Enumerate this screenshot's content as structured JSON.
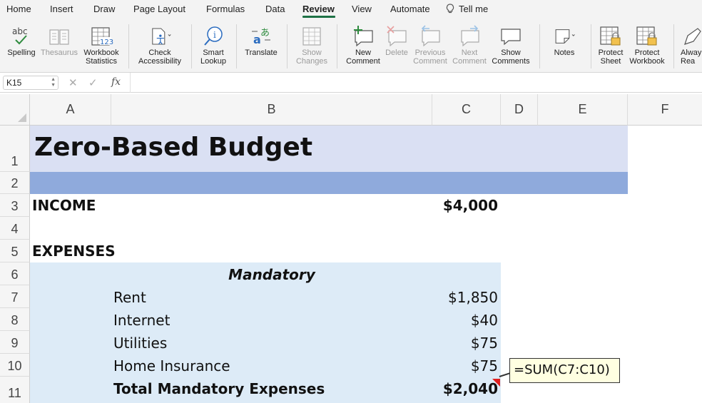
{
  "menu": {
    "tabs": [
      "Home",
      "Insert",
      "Draw",
      "Page Layout",
      "Formulas",
      "Data",
      "Review",
      "View",
      "Automate"
    ],
    "active_tab": "Review",
    "tell_me": "Tell me"
  },
  "ribbon": {
    "buttons": [
      {
        "line1": "Spelling",
        "line2": "",
        "icon": "spelling-icon",
        "enabled": true,
        "icon_text": "abc"
      },
      {
        "line1": "Thesaurus",
        "line2": "",
        "icon": "thesaurus-icon",
        "enabled": false
      },
      {
        "line1": "Workbook",
        "line2": "Statistics",
        "icon": "workbook-statistics-icon",
        "enabled": true,
        "icon_text": "123"
      },
      {
        "line1": "Check",
        "line2": "Accessibility",
        "icon": "accessibility-icon",
        "enabled": true
      },
      {
        "line1": "Smart",
        "line2": "Lookup",
        "icon": "smart-lookup-icon",
        "enabled": true
      },
      {
        "line1": "Translate",
        "line2": "",
        "icon": "translate-icon",
        "enabled": true
      },
      {
        "line1": "Show",
        "line2": "Changes",
        "icon": "show-changes-icon",
        "enabled": false
      },
      {
        "line1": "New",
        "line2": "Comment",
        "icon": "new-comment-icon",
        "enabled": true
      },
      {
        "line1": "Delete",
        "line2": "",
        "icon": "delete-comment-icon",
        "enabled": false
      },
      {
        "line1": "Previous",
        "line2": "Comment",
        "icon": "previous-comment-icon",
        "enabled": false
      },
      {
        "line1": "Next",
        "line2": "Comment",
        "icon": "next-comment-icon",
        "enabled": false
      },
      {
        "line1": "Show",
        "line2": "Comments",
        "icon": "show-comments-icon",
        "enabled": true
      },
      {
        "line1": "Notes",
        "line2": "",
        "icon": "notes-icon",
        "enabled": true
      },
      {
        "line1": "Protect",
        "line2": "Sheet",
        "icon": "protect-sheet-icon",
        "enabled": true
      },
      {
        "line1": "Protect",
        "line2": "Workbook",
        "icon": "protect-workbook-icon",
        "enabled": true
      },
      {
        "line1": "Alway",
        "line2": "Rea",
        "icon": "always-read-icon",
        "enabled": true
      }
    ]
  },
  "formula_bar": {
    "cell_ref": "K15",
    "cancel": "✕",
    "enter": "✓",
    "fx": "fx",
    "value": ""
  },
  "columns": [
    "A",
    "B",
    "C",
    "D",
    "E",
    "F"
  ],
  "rows": [
    "1",
    "2",
    "3",
    "4",
    "5",
    "6",
    "7",
    "8",
    "9",
    "10",
    "11"
  ],
  "sheet": {
    "title": "Zero-Based Budget",
    "income_label": "INCOME",
    "income_value": "$4,000",
    "expenses_label": "EXPENSES",
    "mandatory_header": "Mandatory",
    "items": [
      {
        "label": "Rent",
        "value": "$1,850"
      },
      {
        "label": "Internet",
        "value": "$40"
      },
      {
        "label": "Utilities",
        "value": "$75"
      },
      {
        "label": "Home Insurance",
        "value": "$75"
      }
    ],
    "total_label": "Total Mandatory Expenses",
    "total_value": "$2,040"
  },
  "tooltip": {
    "formula": "=SUM(C7:C10)"
  },
  "colors": {
    "title_fill": "#dae0f3",
    "row2_fill": "#8faadc",
    "mandatory_fill": "#ddebf7",
    "active_tab_underline": "#1e7145",
    "comment_marker": "#e02020"
  }
}
